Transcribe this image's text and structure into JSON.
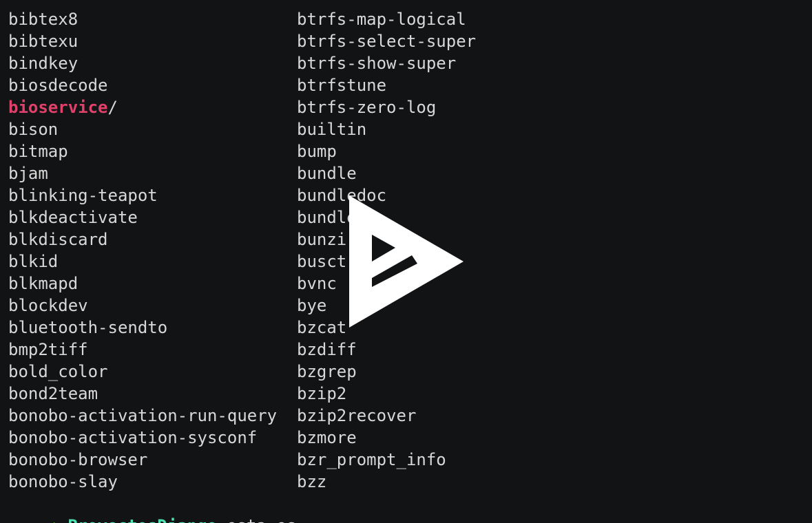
{
  "listing": {
    "left": [
      {
        "name": "bibtex8"
      },
      {
        "name": "bibtexu"
      },
      {
        "name": "bindkey"
      },
      {
        "name": "biosdecode"
      },
      {
        "name": "bioservice",
        "suffix": "/",
        "is_dir": true
      },
      {
        "name": "bison"
      },
      {
        "name": "bitmap"
      },
      {
        "name": "bjam"
      },
      {
        "name": "blinking-teapot"
      },
      {
        "name": "blkdeactivate"
      },
      {
        "name": "blkdiscard"
      },
      {
        "name": "blkid"
      },
      {
        "name": "blkmapd"
      },
      {
        "name": "blockdev"
      },
      {
        "name": "bluetooth-sendto"
      },
      {
        "name": "bmp2tiff"
      },
      {
        "name": "bold_color"
      },
      {
        "name": "bond2team"
      },
      {
        "name": "bonobo-activation-run-query"
      },
      {
        "name": "bonobo-activation-sysconf"
      },
      {
        "name": "bonobo-browser"
      },
      {
        "name": "bonobo-slay"
      }
    ],
    "right": [
      {
        "name": "btrfs-map-logical"
      },
      {
        "name": "btrfs-select-super"
      },
      {
        "name": "btrfs-show-super"
      },
      {
        "name": "btrfstune"
      },
      {
        "name": "btrfs-zero-log"
      },
      {
        "name": "builtin"
      },
      {
        "name": "bump"
      },
      {
        "name": "bundle"
      },
      {
        "name": "bundledoc"
      },
      {
        "name": "bundle"
      },
      {
        "name": "bunzi"
      },
      {
        "name": "busct"
      },
      {
        "name": "bvnc"
      },
      {
        "name": "bye"
      },
      {
        "name": "bzcat"
      },
      {
        "name": "bzdiff"
      },
      {
        "name": "bzgrep"
      },
      {
        "name": "bzip2"
      },
      {
        "name": "bzip2recover"
      },
      {
        "name": "bzmore"
      },
      {
        "name": "bzr_prompt_info"
      },
      {
        "name": "bzz"
      }
    ]
  },
  "prompt": {
    "arrow": "➜",
    "cwd": "ProyectosDjango",
    "command": "esta es"
  },
  "colors": {
    "background": "#121315",
    "text": "#d8d8d8",
    "directory": "#e0416b",
    "arrow": "#5fd700",
    "cwd": "#4fe0b0"
  },
  "overlay": {
    "icon": "asciinema-play-logo-icon"
  }
}
